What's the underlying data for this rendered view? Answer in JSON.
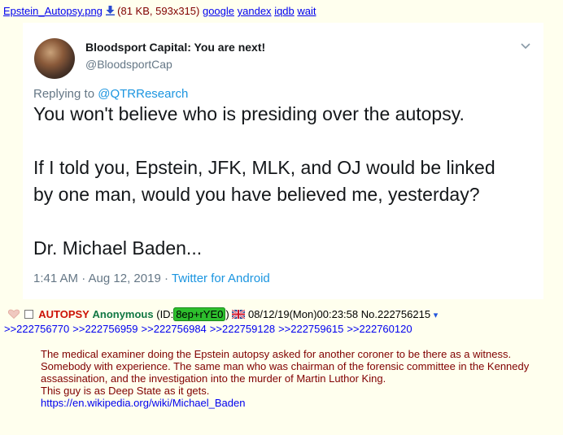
{
  "file": {
    "name": "Epstein_Autopsy.png",
    "meta": "(81 KB, 593x315)",
    "links": [
      "google",
      "yandex",
      "iqdb",
      "wait"
    ]
  },
  "tweet": {
    "display_name": "Bloodsport Capital: You are next!",
    "handle": "@BloodsportCap",
    "replying_prefix": "Replying to",
    "replying_to": "@QTRResearch",
    "lines": [
      "You won't believe who is presiding over the autopsy.",
      "",
      "If I told you, Epstein, JFK, MLK, and OJ would be linked",
      "by one man, would you have believed me, yesterday?",
      "",
      "Dr. Michael Baden..."
    ],
    "timestamp": "1:41 AM · Aug 12, 2019 ·",
    "source": "Twitter for Android"
  },
  "post": {
    "subject": "AUTOPSY",
    "name": "Anonymous",
    "id_prefix": "(ID:",
    "poster_id": "8ep+rYE0",
    "id_suffix": ")",
    "datetime": "08/12/19(Mon)00:23:58",
    "number": "No.222756215",
    "menu_arrow": "▾",
    "backlinks": [
      ">>222756770",
      ">>222756959",
      ">>222756984",
      ">>222759128",
      ">>222759615",
      ">>222760120"
    ],
    "body": [
      "The medical examiner doing the Epstein autopsy asked for another coroner to be there as a witness. Somebody with experience. The same man who was chairman of the forensic committee in the Kennedy assassination, and the investigation into the murder of Martin Luthor King.",
      "This guy is as Deep State as it gets."
    ],
    "link": "https://en.wikipedia.org/wiki/Michael_Baden"
  },
  "icons": {
    "download": "download-icon",
    "heart": "heart-icon",
    "checkbox": "post-select-checkbox",
    "flag": "uk-flag-icon",
    "chevron": "chevron-down-icon"
  }
}
